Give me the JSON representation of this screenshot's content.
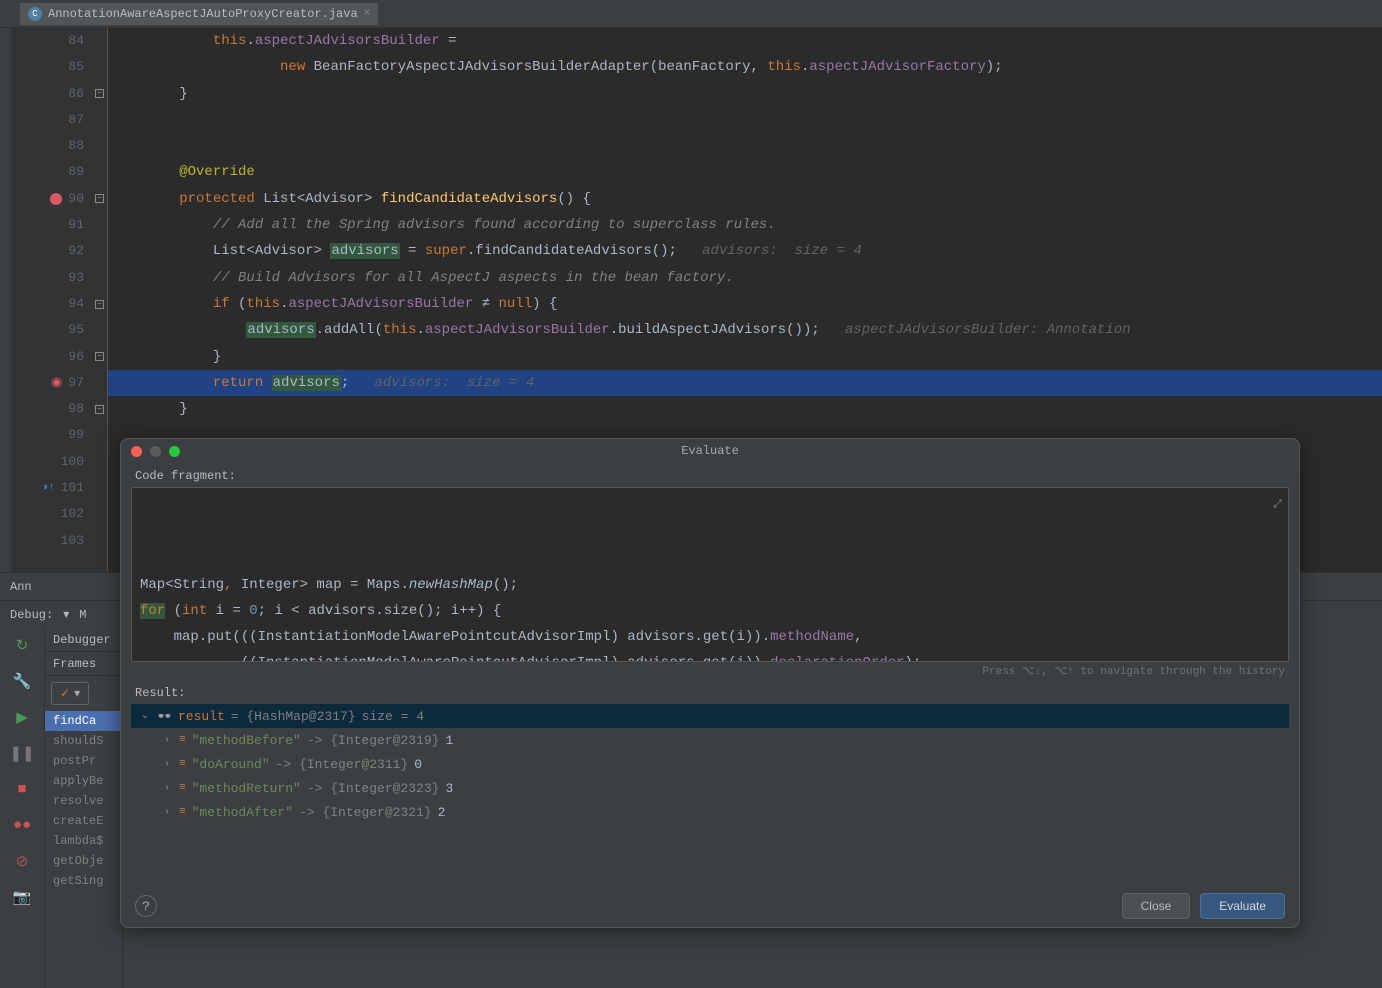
{
  "tab": {
    "filename": "AnnotationAwareAspectJAutoProxyCreator.java",
    "icon_letter": "C"
  },
  "code": {
    "lines": [
      {
        "num": "84",
        "html": "            <span class='kw'>this</span>.<span class='field'>aspectJAdvisorsBuilder</span> ="
      },
      {
        "num": "85",
        "html": "                    <span class='kw'>new</span> <span class='type'>BeanFactoryAspectJAdvisorsBuilderAdapter</span>(beanFactory, <span class='kw'>this</span>.<span class='field'>aspectJAdvisorFactory</span>);"
      },
      {
        "num": "86",
        "html": "        }",
        "fold": "-"
      },
      {
        "num": "87",
        "html": ""
      },
      {
        "num": "88",
        "html": ""
      },
      {
        "num": "89",
        "html": "        <span class='ann'>@Override</span>"
      },
      {
        "num": "90",
        "html": "        <span class='kw'>protected</span> List&lt;Advisor&gt; <span class='fn'>findCandidateAdvisors</span>() {",
        "bp": true,
        "fold": "-"
      },
      {
        "num": "91",
        "html": "            <span class='com'>// Add all the Spring advisors found according to superclass rules.</span>"
      },
      {
        "num": "92",
        "html": "            List&lt;Advisor&gt; <span class='hl-var'>advisors</span> = <span class='kw'>super</span>.findCandidateAdvisors();   <span class='inlay'>advisors:  size = 4</span>"
      },
      {
        "num": "93",
        "html": "            <span class='com'>// Build Advisors for all AspectJ aspects in the bean factory.</span>"
      },
      {
        "num": "94",
        "html": "            <span class='kw'>if</span> (<span class='kw'>this</span>.<span class='field'>aspectJAdvisorsBuilder</span> ≠ <span class='kw'>null</span>) {",
        "fold": "-"
      },
      {
        "num": "95",
        "html": "                <span class='hl-var'>advisors</span>.addAll(<span class='kw'>this</span>.<span class='field'>aspectJAdvisorsBuilder</span>.buildAspectJAdvisors());   <span class='inlay'>aspectJAdvisorsBuilder: Annotation</span>"
      },
      {
        "num": "96",
        "html": "            }",
        "fold": "-"
      },
      {
        "num": "97",
        "html": "            <span class='kw'>return</span> <span class='hl-var'>advisors</span>;   <span class='inlay'>advisors:  size = 4</span>",
        "hl": true,
        "bpdone": true
      },
      {
        "num": "98",
        "html": "        }",
        "fold": "-"
      },
      {
        "num": "99",
        "html": ""
      },
      {
        "num": "100",
        "html": ""
      },
      {
        "num": "101",
        "html": "",
        "up": true
      },
      {
        "num": "102",
        "html": ""
      },
      {
        "num": "103",
        "html": ""
      }
    ],
    "bottom_label": "Ann"
  },
  "debug": {
    "label": "Debug:",
    "tab": "M",
    "tab2": "Debugger",
    "frames_label": "Frames",
    "filter": "✓",
    "frames": [
      {
        "text": "findCa",
        "active": true
      },
      {
        "text": "shouldS"
      },
      {
        "text": "postPr"
      },
      {
        "text": "applyBe"
      },
      {
        "text": "resolve"
      },
      {
        "text": "createE"
      },
      {
        "text": "lambda$"
      },
      {
        "text": "getObje"
      },
      {
        "text": "getSing"
      }
    ]
  },
  "evaluate": {
    "title": "Evaluate",
    "code_fragment_label": "Code fragment:",
    "code_html": "Map&lt;String<span class='kw'>,</span> Integer&gt; map = Maps.<span style='font-style:italic;'>newHashMap</span>();\n<span style='background:#32593d;'><span class='kw'>for</span></span> (<span class='kw'>int</span> i = <span class='num'>0</span>; i &lt; advisors.size(); i++) {\n    map.put(((InstantiationModelAwarePointcutAdvisorImpl) advisors.get(i)).<span class='field'>methodName</span>,\n            ((InstantiationModelAwarePointcutAdvisorImpl) advisors.get(i)).<span class='field'>declarationOrder</span>);\n}\n<span class='kw'>return</span> map;",
    "hint": "Press ⌥↓, ⌥↑ to navigate through the history",
    "result_label": "Result:",
    "result_root": {
      "name": "result",
      "value": "{HashMap@2317}",
      "extra": "size = 4"
    },
    "result_children": [
      {
        "key": "\"methodBefore\"",
        "val": "{Integer@2319}",
        "n": "1"
      },
      {
        "key": "\"doAround\"",
        "val": "{Integer@2311}",
        "n": "0"
      },
      {
        "key": "\"methodReturn\"",
        "val": "{Integer@2323}",
        "n": "3"
      },
      {
        "key": "\"methodAfter\"",
        "val": "{Integer@2321}",
        "n": "2"
      }
    ],
    "close_label": "Close",
    "evaluate_label": "Evaluate"
  }
}
